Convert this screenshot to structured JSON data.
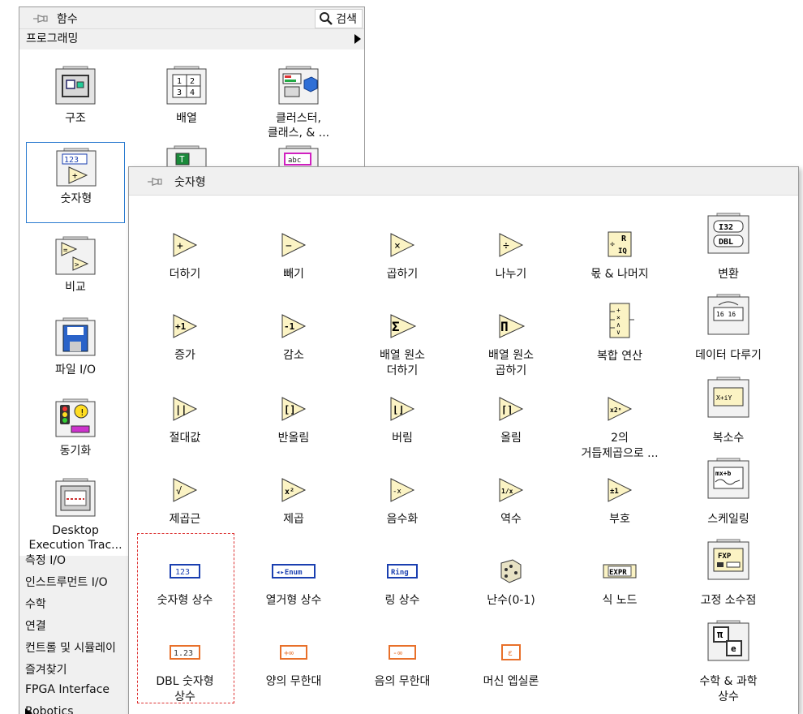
{
  "functions_palette": {
    "title": "함수",
    "search_label": "검색",
    "category": "프로그래밍",
    "items": [
      {
        "label": "구조",
        "icon": "structures-icon"
      },
      {
        "label": "배열",
        "icon": "array-icon"
      },
      {
        "label": "클러스터,\n클래스, & ...",
        "icon": "cluster-class-icon"
      },
      {
        "label": "숫자형",
        "icon": "numeric-icon",
        "selected": true
      },
      {
        "label": "",
        "icon": "boolean-icon"
      },
      {
        "label": "",
        "icon": "string-icon"
      },
      {
        "label": "비교",
        "icon": "comparison-icon"
      },
      {
        "label": "파일 I/O",
        "icon": "file-io-icon"
      },
      {
        "label": "동기화",
        "icon": "synchronization-icon"
      },
      {
        "label": "Desktop\nExecution Trac...",
        "icon": "desktop-execution-trace-icon"
      }
    ],
    "list": [
      {
        "label": "측정 I/O"
      },
      {
        "label": "인스트루먼트 I/O"
      },
      {
        "label": "수학"
      },
      {
        "label": "연결"
      },
      {
        "label": "컨트롤 및 시뮬레이"
      },
      {
        "label": "즐겨찾기"
      },
      {
        "label": "FPGA Interface"
      },
      {
        "label": "Robotics"
      }
    ]
  },
  "numeric_palette": {
    "title": "숫자형",
    "items": [
      {
        "label": "더하기",
        "icon": "add-icon"
      },
      {
        "label": "빼기",
        "icon": "subtract-icon"
      },
      {
        "label": "곱하기",
        "icon": "multiply-icon"
      },
      {
        "label": "나누기",
        "icon": "divide-icon"
      },
      {
        "label": "몫 & 나머지",
        "icon": "quotient-remainder-icon"
      },
      {
        "label": "변환",
        "icon": "conversion-icon"
      },
      {
        "label": "증가",
        "icon": "increment-icon"
      },
      {
        "label": "감소",
        "icon": "decrement-icon"
      },
      {
        "label": "배열 원소\n더하기",
        "icon": "add-array-elements-icon"
      },
      {
        "label": "배열 원소\n곱하기",
        "icon": "multiply-array-elements-icon"
      },
      {
        "label": "복합 연산",
        "icon": "compound-arithmetic-icon"
      },
      {
        "label": "데이터 다루기",
        "icon": "data-manipulation-icon"
      },
      {
        "label": "절대값",
        "icon": "absolute-value-icon"
      },
      {
        "label": "반올림",
        "icon": "round-nearest-icon"
      },
      {
        "label": "버림",
        "icon": "round-down-icon"
      },
      {
        "label": "올림",
        "icon": "round-up-icon"
      },
      {
        "label": "2의\n거듭제곱으로 ...",
        "icon": "scale-by-power-of-2-icon"
      },
      {
        "label": "복소수",
        "icon": "complex-icon"
      },
      {
        "label": "제곱근",
        "icon": "square-root-icon"
      },
      {
        "label": "제곱",
        "icon": "square-icon"
      },
      {
        "label": "음수화",
        "icon": "negate-icon"
      },
      {
        "label": "역수",
        "icon": "reciprocal-icon"
      },
      {
        "label": "부호",
        "icon": "sign-icon"
      },
      {
        "label": "스케일링",
        "icon": "scaling-icon"
      },
      {
        "label": "숫자형 상수",
        "icon": "numeric-constant-icon"
      },
      {
        "label": "열거형 상수",
        "icon": "enum-constant-icon"
      },
      {
        "label": "링 상수",
        "icon": "ring-constant-icon"
      },
      {
        "label": "난수(0-1)",
        "icon": "random-number-icon"
      },
      {
        "label": "식 노드",
        "icon": "expression-node-icon"
      },
      {
        "label": "고정 소수점",
        "icon": "fixed-point-icon"
      },
      {
        "label": "DBL 숫자형\n상수",
        "icon": "dbl-numeric-constant-icon"
      },
      {
        "label": "양의 무한대",
        "icon": "positive-infinity-icon"
      },
      {
        "label": "음의 무한대",
        "icon": "negative-infinity-icon"
      },
      {
        "label": "머신 엡실론",
        "icon": "machine-epsilon-icon"
      },
      {
        "label": "수학 & 과학\n상수",
        "icon": "math-science-constants-icon"
      }
    ],
    "icon_glyphs": {
      "add": "+",
      "subtract": "−",
      "multiply": "×",
      "divide": "÷",
      "increment": "+1",
      "decrement": "-1",
      "sigma": "Σ",
      "pi": "Π",
      "abs": "|·|",
      "round": "[·]",
      "floor": "⌊·⌋",
      "ceil": "⌈·⌉",
      "pow2": "x2ⁿ",
      "sqrt": "√",
      "sq": "x²",
      "neg": "-x",
      "recip": "1/x",
      "sign": "±1"
    },
    "constants": {
      "numeric": "123",
      "enum": "◂▸Enum",
      "ring": "Ring",
      "expr": "EXPR",
      "dbl": "1.23",
      "pos_inf": "+∞",
      "neg_inf": "-∞",
      "epsilon": "ε",
      "fxp": "FXP",
      "i32": "I32",
      "dbl_conv": "DBL",
      "complex": "X+iY",
      "scaling": "mx+b",
      "qr_r": "R",
      "qr_iq": "IQ",
      "data": "16 16",
      "cluster_abc": "abc",
      "array_nums": "1 2 3 4",
      "bool_t": "T",
      "math_pi": "π",
      "math_e": "e"
    }
  },
  "colors": {
    "triangle_fill": "#fbf3c4",
    "selection_blue": "#2b7bd0",
    "dashed_red": "#dd3333",
    "constant_blue": "#1a3fb0",
    "constant_orange": "#e8702a"
  }
}
